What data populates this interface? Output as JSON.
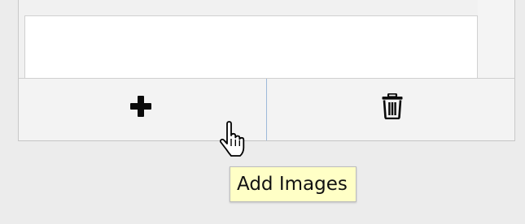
{
  "toolbar": {
    "add_button": {
      "icon": "plus-icon",
      "tooltip": "Add Images"
    },
    "delete_button": {
      "icon": "trash-icon"
    }
  },
  "cursor": {
    "icon": "hand-pointer-icon"
  },
  "colors": {
    "separator_accent": "#9db9d9",
    "tooltip_background": "#ffffc6"
  }
}
